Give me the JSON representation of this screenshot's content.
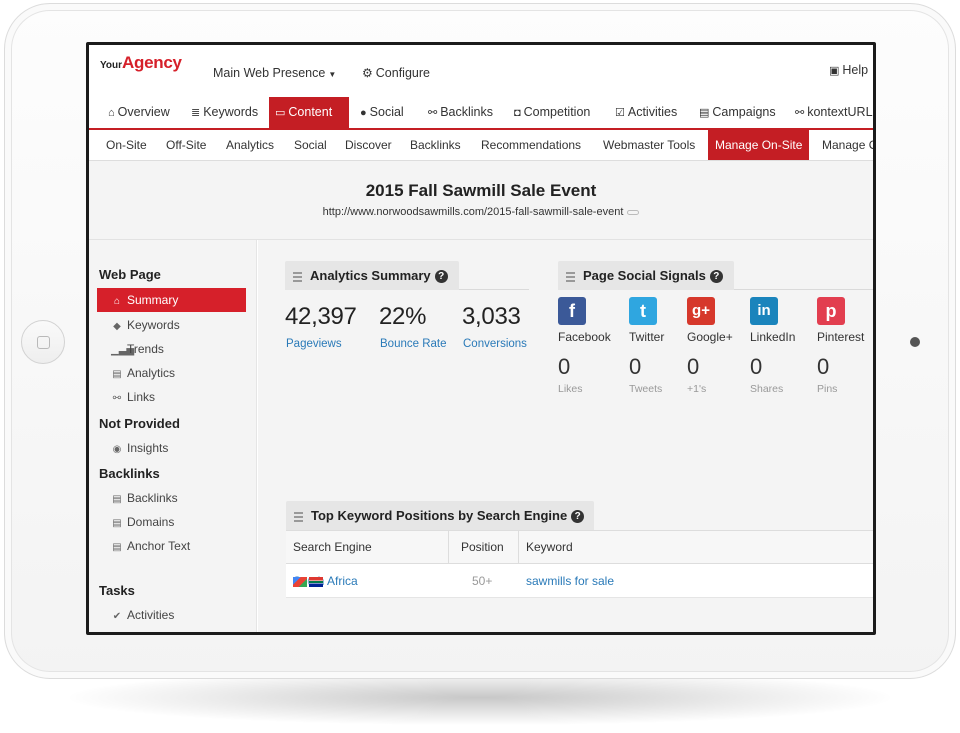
{
  "brand": {
    "prefix": "Your",
    "name": "Agency"
  },
  "topbar": {
    "presence": "Main Web Presence",
    "configure": "Configure",
    "help": "Help"
  },
  "mainnav": [
    {
      "label": "Overview",
      "icon": "home-icon"
    },
    {
      "label": "Keywords",
      "icon": "list-icon"
    },
    {
      "label": "Content",
      "icon": "monitor-icon",
      "active": true
    },
    {
      "label": "Social",
      "icon": "chat-icon"
    },
    {
      "label": "Backlinks",
      "icon": "link-icon"
    },
    {
      "label": "Competition",
      "icon": "shield-icon"
    },
    {
      "label": "Activities",
      "icon": "checkbox-icon"
    },
    {
      "label": "Campaigns",
      "icon": "book-icon"
    },
    {
      "label": "kontextURL",
      "icon": "link-icon"
    }
  ],
  "subnav": [
    "On-Site",
    "Off-Site",
    "Analytics",
    "Social",
    "Discover",
    "Backlinks",
    "Recommendations",
    "Webmaster Tools",
    "Manage On-Site",
    "Manage O"
  ],
  "page": {
    "title": "2015 Fall Sawmill Sale Event",
    "url": "http://www.norwoodsawmills.com/2015-fall-sawmill-sale-event"
  },
  "sidebar": {
    "sections": [
      {
        "heading": "Web Page",
        "items": [
          "Summary",
          "Keywords",
          "Trends",
          "Analytics",
          "Links"
        ]
      },
      {
        "heading": "Not Provided",
        "items": [
          "Insights"
        ]
      },
      {
        "heading": "Backlinks",
        "items": [
          "Backlinks",
          "Domains",
          "Anchor Text"
        ]
      },
      {
        "heading": "Tasks",
        "items": [
          "Activities"
        ]
      }
    ]
  },
  "analytics": {
    "title": "Analytics Summary",
    "stats": [
      {
        "value": "42,397",
        "label": "Pageviews"
      },
      {
        "value": "22%",
        "label": "Bounce Rate"
      },
      {
        "value": "3,033",
        "label": "Conversions"
      }
    ]
  },
  "social": {
    "title": "Page Social Signals",
    "networks": [
      {
        "name": "Facebook",
        "count": "0",
        "unit": "Likes",
        "color": "#3b5998",
        "glyph": "f"
      },
      {
        "name": "Twitter",
        "count": "0",
        "unit": "Tweets",
        "color": "#2fa6e0",
        "glyph": "t"
      },
      {
        "name": "Google+",
        "count": "0",
        "unit": "+1's",
        "color": "#d6382b",
        "glyph": "g+"
      },
      {
        "name": "LinkedIn",
        "count": "0",
        "unit": "Shares",
        "color": "#1a84bc",
        "glyph": "in"
      },
      {
        "name": "Pinterest",
        "count": "0",
        "unit": "Pins",
        "color": "#e23e4f",
        "glyph": "p"
      }
    ]
  },
  "keywords": {
    "title": "Top Keyword Positions by Search Engine",
    "columns": [
      "Search Engine",
      "Position",
      "Keyword"
    ],
    "rows": [
      {
        "engine": "South Africa",
        "position": "50+",
        "keyword": "sawmills for sale"
      }
    ]
  },
  "colors": {
    "accent": "#c41e24",
    "link": "#2a7ab8"
  }
}
